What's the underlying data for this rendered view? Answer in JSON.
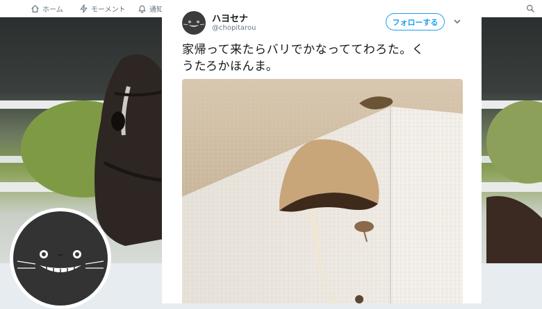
{
  "nav": {
    "home_label": "ホーム",
    "moments_label": "モーメント",
    "notifications_label": "通知",
    "icons": {
      "home": "home-icon",
      "moments": "lightning-icon",
      "notifications": "bell-icon",
      "search": "search-icon"
    }
  },
  "tweet": {
    "display_name": "ハヨセナ",
    "screen_name": "@chopitarou",
    "follow_label": "フォローする",
    "text_line_1": "家帰って来たらバリでかなっててわろた。く",
    "text_line_2": "うたろかほんま。"
  },
  "colors": {
    "accent": "#1da1f2",
    "text": "#14171a",
    "muted": "#657786",
    "page_bg": "#e6ecf0"
  }
}
